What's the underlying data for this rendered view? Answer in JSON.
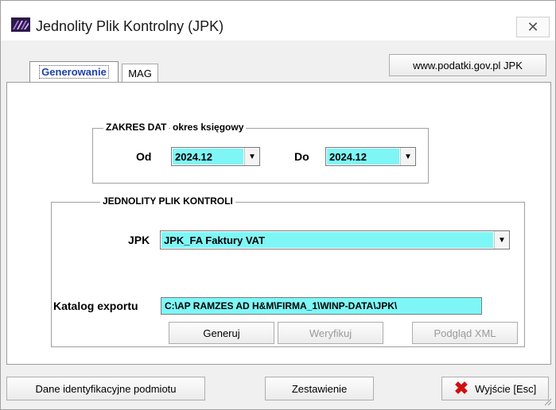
{
  "window": {
    "title": "Jednolity Plik Kontrolny  (JPK)",
    "close_glyph": "✕"
  },
  "tabs": [
    {
      "label": "Generowanie",
      "active": true
    },
    {
      "label": "MAG",
      "active": false
    }
  ],
  "link_button": {
    "label": "www.podatki.gov.pl  JPK"
  },
  "zakres": {
    "title": "ZAKRES DAT",
    "subtitle": "okres księgowy",
    "od_label": "Od",
    "od_value": "2024.12",
    "do_label": "Do",
    "do_value": "2024.12"
  },
  "jpk_group": {
    "title": "JEDNOLITY PLIK KONTROLI",
    "jpk_label": "JPK",
    "jpk_value": "JPK_FA Faktury VAT",
    "katalog_label": "Katalog exportu",
    "katalog_value": "C:\\AP RAMZES AD H&M\\FIRMA_1\\WINP-DATA\\JPK\\"
  },
  "actions": {
    "generuj": "Generuj",
    "weryfikuj": "Weryfikuj",
    "podglad": "Podgląd XML"
  },
  "footer": {
    "dane": "Dane identyfikacyjne podmiotu",
    "zestawienie": "Zestawienie",
    "wyjscie": "Wyjście  [Esc]"
  },
  "colors": {
    "field_highlight": "#7ff6f6",
    "active_tab_text": "#1b3fa8",
    "exit_icon": "#d01010"
  }
}
